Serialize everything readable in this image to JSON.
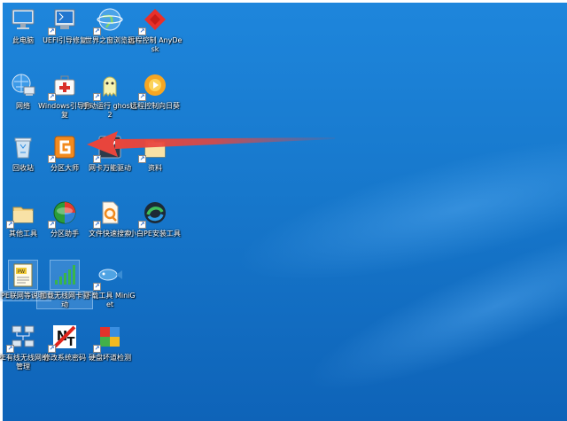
{
  "desktop": {
    "background_color": "#1778cc",
    "arrow_color": "#e8453c",
    "icons": [
      {
        "label": "此电脑",
        "icon": "computer-icon"
      },
      {
        "label": "UEFI引导修复",
        "icon": "uefi-repair-icon"
      },
      {
        "label": "世界之窗浏览器",
        "icon": "browser-globe-icon"
      },
      {
        "label": "远程控制 AnyDesk",
        "icon": "anydesk-icon"
      },
      {
        "label": "网络",
        "icon": "network-icon"
      },
      {
        "label": "Windows引导修复",
        "icon": "windows-boot-repair-icon"
      },
      {
        "label": "手动运行 ghost12",
        "icon": "ghost-icon"
      },
      {
        "label": "远程控制向日葵",
        "icon": "sunflower-icon"
      },
      {
        "label": "回收站",
        "icon": "recycle-bin-icon"
      },
      {
        "label": "分区大师",
        "icon": "partition-master-icon"
      },
      {
        "label": "网卡万能驱动",
        "icon": "nic-driver-icon"
      },
      {
        "label": "资料",
        "icon": "folder-icon"
      },
      {
        "label": "其他工具",
        "icon": "tools-folder-icon"
      },
      {
        "label": "分区助手",
        "icon": "partition-assistant-icon"
      },
      {
        "label": "文件快速搜索",
        "icon": "file-search-icon"
      },
      {
        "label": "小白PE安装工具",
        "icon": "xiaobai-pe-icon"
      },
      {
        "label": "PE联网等说明",
        "icon": "pe-readme-icon"
      },
      {
        "label": "加载无线网卡驱动",
        "icon": "wifi-driver-icon"
      },
      {
        "label": "下载工具 MiniGet",
        "icon": "miniget-fish-icon"
      },
      {
        "label": "PE有线无线网络管理",
        "icon": "network-manager-icon"
      },
      {
        "label": "修改系统密码",
        "icon": "nt-password-icon"
      },
      {
        "label": "硬盘坏道检测",
        "icon": "disk-check-icon"
      }
    ]
  }
}
